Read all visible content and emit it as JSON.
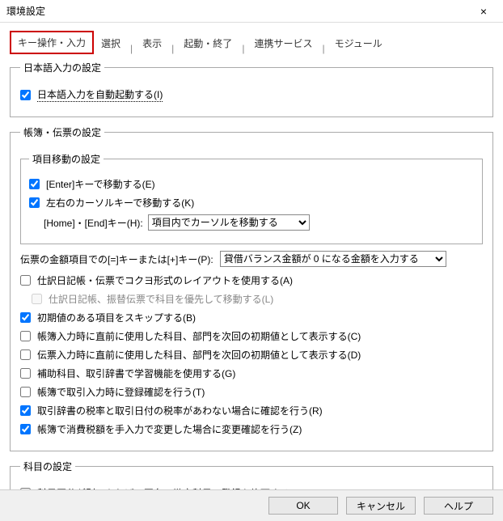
{
  "window": {
    "title": "環境設定",
    "close": "×"
  },
  "tabs": {
    "items": [
      "キー操作・入力",
      "選択",
      "表示",
      "起動・終了",
      "連携サービス",
      "モジュール"
    ]
  },
  "ime_group": {
    "legend": "日本語入力の設定",
    "auto_start": "日本語入力を自動起動する(I)"
  },
  "book_group": {
    "legend": "帳簿・伝票の設定",
    "move_group_legend": "項目移動の設定",
    "enter_move": "[Enter]キーで移動する(E)",
    "arrow_move": "左右のカーソルキーで移動する(K)",
    "home_end_label": "[Home]・[End]キー(H):",
    "home_end_option": "項目内でカーソルを移動する",
    "amount_label": "伝票の金額項目での[=]キーまたは[+]キー(P):",
    "amount_option": "貸借バランス金額が 0 になる金額を入力する",
    "c1": "仕訳日記帳・伝票でコクヨ形式のレイアウトを使用する(A)",
    "c1a": "仕訳日記帳、振替伝票で科目を優先して移動する(L)",
    "c2": "初期値のある項目をスキップする(B)",
    "c3": "帳簿入力時に直前に使用した科目、部門を次回の初期値として表示する(C)",
    "c4": "伝票入力時に直前に使用した科目、部門を次回の初期値として表示する(D)",
    "c5": "補助科目、取引辞書で学習機能を使用する(G)",
    "c6": "帳簿で取引入力時に登録確認を行う(T)",
    "c7": "取引辞書の税率と取引日付の税率があわない場合に確認を行う(R)",
    "c8": "帳簿で消費税額を手入力で変更した場合に変更確認を行う(Z)"
  },
  "account_group": {
    "legend": "科目の設定",
    "c1": "科目区分が別であれば、同名の勘定科目の登録を許可する(S)"
  },
  "buttons": {
    "ok": "OK",
    "cancel": "キャンセル",
    "help": "ヘルプ"
  }
}
